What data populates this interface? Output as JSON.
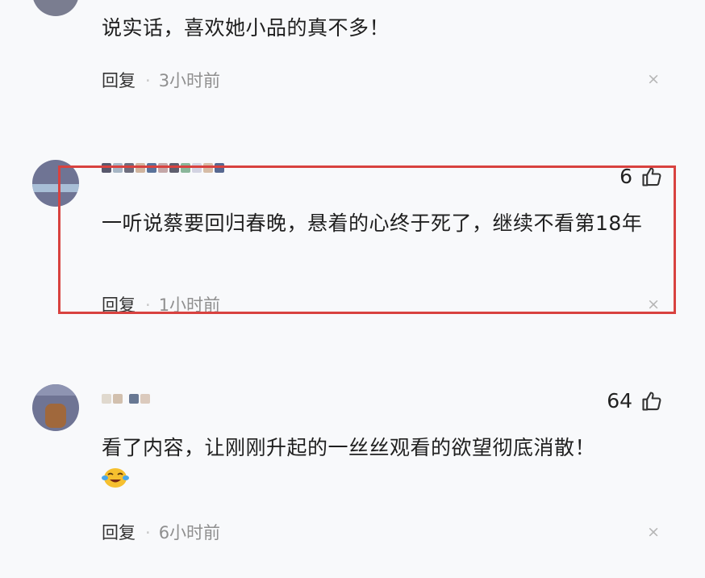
{
  "comments": [
    {
      "text": "说实话，喜欢她小品的真不多！",
      "reply_label": "回复",
      "separator": "·",
      "time": "3小时前",
      "close": "×"
    },
    {
      "likes": "6",
      "text": "一听说蔡要回归春晚，悬着的心终于死了，继续不看第18年",
      "reply_label": "回复",
      "separator": "·",
      "time": "1小时前",
      "close": "×"
    },
    {
      "likes": "64",
      "text": "看了内容，让刚刚升起的一丝丝观看的欲望彻底消散！",
      "reply_label": "回复",
      "separator": "·",
      "time": "6小时前",
      "close": "×"
    }
  ],
  "colors": {
    "highlight_border": "#d8423f",
    "background": "#f8f9fb"
  },
  "icons": [
    "thumbs-up-icon",
    "close-icon",
    "laughing-crying-emoji-icon"
  ]
}
